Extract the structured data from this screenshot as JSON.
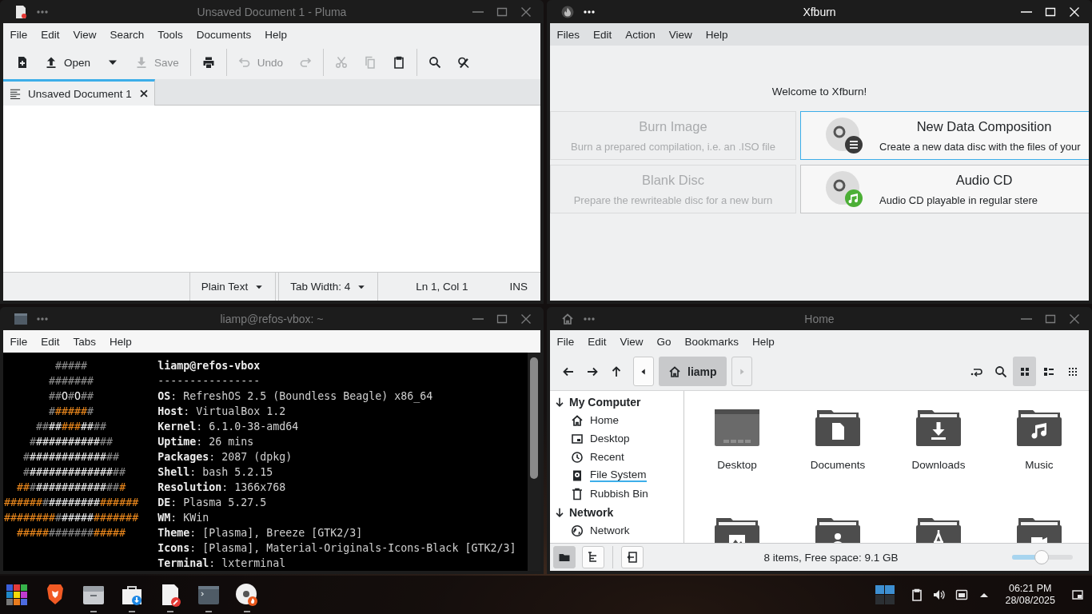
{
  "pluma": {
    "window": {
      "title": "Unsaved Document 1 - Pluma",
      "active": false
    },
    "menu": [
      "File",
      "Edit",
      "View",
      "Search",
      "Tools",
      "Documents",
      "Help"
    ],
    "toolbar": [
      {
        "disabled": false
      },
      {
        "label": "Open",
        "disabled": false
      },
      {
        "disabled": false
      },
      {
        "label": "Save",
        "disabled": true
      },
      {
        "disabled": false
      },
      {
        "label": "Undo",
        "disabled": true
      },
      {
        "disabled": true
      },
      {
        "disabled": true
      },
      {
        "disabled": true
      },
      {
        "disabled": false
      },
      {
        "disabled": false
      },
      {
        "disabled": false
      }
    ],
    "tabs": [
      {
        "label": "Unsaved Document 1",
        "selected": true
      }
    ],
    "status_bar": {
      "language": "Plain Text",
      "tab_width": "Tab Width: 4",
      "position": "Ln 1, Col 1",
      "mode": "INS"
    }
  },
  "xfburn": {
    "window": {
      "title": "Xfburn",
      "active": true
    },
    "menu": [
      "Files",
      "Edit",
      "Action",
      "View",
      "Help"
    ],
    "welcome": "Welcome to Xfburn!",
    "actions": [
      {
        "title": "Burn Image",
        "description": "Burn a prepared compilation, i.e. an .ISO file",
        "disabled": true,
        "focused": false
      },
      {
        "title": "New Data Composition",
        "description": "Create a new data disc with the files of your",
        "disabled": false,
        "focused": true
      },
      {
        "title": "Blank Disc",
        "description": "Prepare the rewriteable disc for a new burn",
        "disabled": true,
        "focused": false
      },
      {
        "title": "Audio CD",
        "description": "Audio CD playable in regular stere",
        "disabled": false,
        "focused": false
      }
    ]
  },
  "terminal": {
    "window": {
      "title": "liamp@refos-vbox: ~",
      "active": false
    },
    "menu": [
      "File",
      "Edit",
      "Tabs",
      "Help"
    ],
    "lines": [
      {
        "kind": "header",
        "art": [
          {
            "text": "        #####",
            "color": "#8a8a8a"
          }
        ],
        "text": "liamp@refos-vbox"
      },
      {
        "kind": "separator",
        "art": [
          {
            "text": "       #######",
            "color": "#8a8a8a"
          }
        ],
        "text": "----------------"
      },
      {
        "kind": "field",
        "art": [
          {
            "text": "       ##",
            "color": "#8a8a8a"
          },
          {
            "text": "O",
            "color": "#f2f2f2"
          },
          {
            "text": "#",
            "color": "#8a8a8a"
          },
          {
            "text": "O",
            "color": "#f2f2f2"
          },
          {
            "text": "##",
            "color": "#8a8a8a"
          }
        ],
        "text": "**OS**: RefreshOS 2.5 (Boundless Beagle) x86_64"
      },
      {
        "kind": "field",
        "art": [
          {
            "text": "       #",
            "color": "#8a8a8a"
          },
          {
            "text": "#####",
            "color": "#e8861c"
          },
          {
            "text": "#",
            "color": "#8a8a8a"
          }
        ],
        "text": "**Host**: VirtualBox 1.2"
      },
      {
        "kind": "field",
        "art": [
          {
            "text": "     ##",
            "color": "#8a8a8a"
          },
          {
            "text": "##",
            "color": "#e6e6e6"
          },
          {
            "text": "###",
            "color": "#e8861c"
          },
          {
            "text": "##",
            "color": "#e6e6e6"
          },
          {
            "text": "##",
            "color": "#8a8a8a"
          }
        ],
        "text": "**Kernel**: 6.1.0-38-amd64"
      },
      {
        "kind": "field",
        "art": [
          {
            "text": "    #",
            "color": "#8a8a8a"
          },
          {
            "text": "##########",
            "color": "#e6e6e6"
          },
          {
            "text": "##",
            "color": "#8a8a8a"
          }
        ],
        "text": "**Uptime**: 26 mins"
      },
      {
        "kind": "field",
        "art": [
          {
            "text": "   #",
            "color": "#8a8a8a"
          },
          {
            "text": "############",
            "color": "#e6e6e6"
          },
          {
            "text": "##",
            "color": "#8a8a8a"
          }
        ],
        "text": "**Packages**: 2087 (dpkg)"
      },
      {
        "kind": "field",
        "art": [
          {
            "text": "   #",
            "color": "#8a8a8a"
          },
          {
            "text": "#############",
            "color": "#e6e6e6"
          },
          {
            "text": "##",
            "color": "#8a8a8a"
          }
        ],
        "text": "**Shell**: bash 5.2.15"
      },
      {
        "kind": "field",
        "art": [
          {
            "text": "  ##",
            "color": "#e8861c"
          },
          {
            "text": "#",
            "color": "#8a8a8a"
          },
          {
            "text": "###########",
            "color": "#e6e6e6"
          },
          {
            "text": "##",
            "color": "#8a8a8a"
          },
          {
            "text": "#",
            "color": "#e8861c"
          }
        ],
        "text": "**Resolution**: 1366x768"
      },
      {
        "kind": "field",
        "art": [
          {
            "text": "######",
            "color": "#e8861c"
          },
          {
            "text": "#",
            "color": "#8a8a8a"
          },
          {
            "text": "########",
            "color": "#e6e6e6"
          },
          {
            "text": "######",
            "color": "#e8861c"
          }
        ],
        "text": "**DE**: Plasma 5.27.5"
      },
      {
        "kind": "field",
        "art": [
          {
            "text": "########",
            "color": "#e8861c"
          },
          {
            "text": "#",
            "color": "#8a8a8a"
          },
          {
            "text": "#####",
            "color": "#e6e6e6"
          },
          {
            "text": "#######",
            "color": "#e8861c"
          }
        ],
        "text": "**WM**: KWin"
      },
      {
        "kind": "field",
        "art": [
          {
            "text": "  #####",
            "color": "#e8861c"
          },
          {
            "text": "#######",
            "color": "#8a8a8a"
          },
          {
            "text": "#####",
            "color": "#e8861c"
          }
        ],
        "text": "**Theme**: [Plasma], Breeze [GTK2/3]"
      },
      {
        "kind": "field",
        "text": "**Icons**: [Plasma], Material-Originals-Icons-Black [GTK2/3]"
      },
      {
        "kind": "field",
        "text": "**Terminal**: lxterminal"
      }
    ]
  },
  "files": {
    "window": {
      "title": "Home",
      "active": false
    },
    "menu": [
      "File",
      "Edit",
      "View",
      "Go",
      "Bookmarks",
      "Help"
    ],
    "breadcrumb": [
      {
        "label": "liamp",
        "selected": true
      }
    ],
    "views": [
      {
        "selected": true
      },
      {
        "selected": false
      },
      {
        "selected": false
      }
    ],
    "sidebar": [
      {
        "title": "My Computer",
        "expanded": true,
        "items": [
          {
            "label": "Home",
            "selected": false
          },
          {
            "label": "Desktop",
            "selected": false
          },
          {
            "label": "Recent",
            "selected": false
          },
          {
            "label": "File System",
            "selected": true
          },
          {
            "label": "Rubbish Bin",
            "selected": false
          }
        ]
      },
      {
        "title": "Network",
        "expanded": true,
        "items": [
          {
            "label": "Network",
            "selected": false
          }
        ]
      }
    ],
    "items": [
      {
        "name": "Desktop"
      },
      {
        "name": "Documents"
      },
      {
        "name": "Downloads"
      },
      {
        "name": "Music"
      }
    ],
    "panes": [
      {
        "selected": true
      },
      {
        "selected": false
      }
    ],
    "status": "8 items, Free space: 9.1 GB",
    "zoom": {
      "level": 0.49
    }
  },
  "taskbar": {
    "launchers": [
      {
        "running": false
      },
      {
        "running": false
      },
      {
        "running": true
      },
      {
        "running": true
      },
      {
        "running": true
      },
      {
        "running": true
      },
      {
        "running": true
      }
    ],
    "clock": {
      "time": "06:21 PM",
      "date": "28/08/2025"
    }
  }
}
